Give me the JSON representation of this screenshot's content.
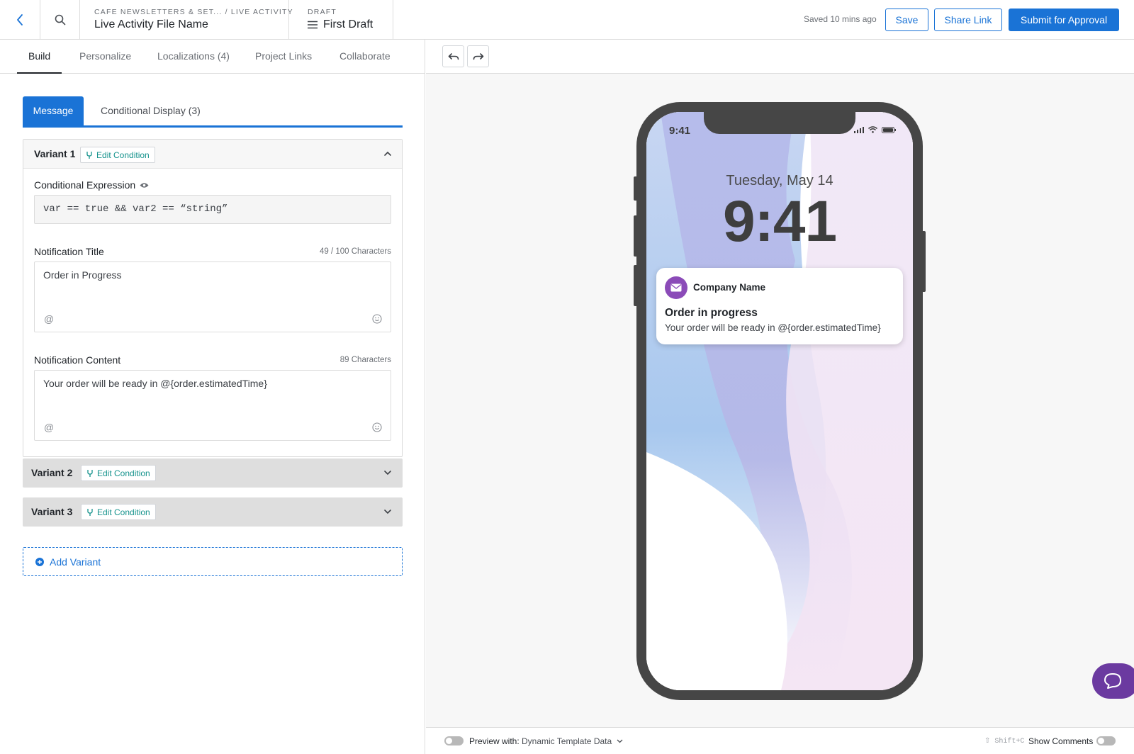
{
  "header": {
    "breadcrumb": "CAFE NEWSLETTERS & SET... / LIVE ACTIVITY",
    "file_name": "Live Activity File Name",
    "draft_label": "DRAFT",
    "draft_name": "First Draft",
    "saved_status": "Saved 10 mins ago",
    "save_label": "Save",
    "share_label": "Share Link",
    "submit_label": "Submit for Approval"
  },
  "tabs": [
    {
      "label": "Build",
      "active": true
    },
    {
      "label": "Personalize",
      "active": false
    },
    {
      "label": "Localizations (4)",
      "active": false
    },
    {
      "label": "Project Links",
      "active": false
    },
    {
      "label": "Collaborate",
      "active": false
    }
  ],
  "subtabs": {
    "message": "Message",
    "conditional": "Conditional Display (3)"
  },
  "variants": [
    {
      "label": "Variant 1",
      "edit": "Edit Condition",
      "expanded": true
    },
    {
      "label": "Variant 2",
      "edit": "Edit Condition",
      "expanded": false
    },
    {
      "label": "Variant 3",
      "edit": "Edit Condition",
      "expanded": false
    }
  ],
  "variant1": {
    "expression_label": "Conditional Expression",
    "expression_value": "var == true && var2 == “string”",
    "title_label": "Notification Title",
    "title_count": "49 / 100 Characters",
    "title_value": "Order in Progress",
    "content_label": "Notification Content",
    "content_count": "89 Characters",
    "content_value": "Your order will be ready in @{order.estimatedTime}",
    "mention_symbol": "@"
  },
  "add_variant": "Add Variant",
  "preview": {
    "status_time": "9:41",
    "date": "Tuesday, May 14",
    "time": "9:41",
    "notification": {
      "company": "Company Name",
      "title": "Order in progress",
      "body": "Your order will be ready in @{order.estimatedTime}"
    }
  },
  "bottom_bar": {
    "preview_label": "Preview with:",
    "preview_value": "Dynamic Template Data",
    "shortcut": "⇧ Shift+C",
    "show_comments": "Show Comments"
  },
  "colors": {
    "accent": "#1a73d6",
    "teal": "#14928c",
    "purple": "#8b4bb8",
    "chat": "#6b3aa0"
  },
  "icons": [
    "back-arrow-icon",
    "search-icon",
    "hamburger-icon",
    "branch-icon",
    "chevron-up-icon",
    "chevron-down-icon",
    "eye-icon",
    "emoji-icon",
    "plus-circle-icon",
    "undo-icon",
    "redo-icon",
    "mail-icon",
    "chat-icon"
  ]
}
